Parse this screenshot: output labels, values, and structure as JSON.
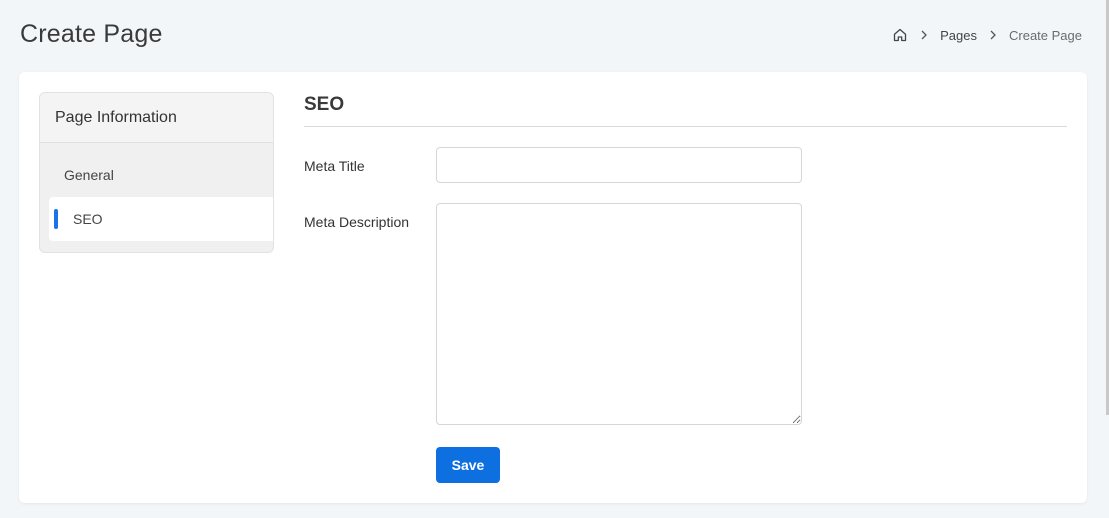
{
  "header": {
    "title": "Create Page",
    "breadcrumb": {
      "home_icon": "home-icon",
      "separator_icon": "chevron-right-icon",
      "items": [
        "Pages",
        "Create Page"
      ]
    }
  },
  "sidebar": {
    "title": "Page Information",
    "items": [
      {
        "label": "General",
        "active": false
      },
      {
        "label": "SEO",
        "active": true
      }
    ]
  },
  "main": {
    "section_title": "SEO",
    "fields": {
      "meta_title": {
        "label": "Meta Title",
        "value": "",
        "placeholder": ""
      },
      "meta_description": {
        "label": "Meta Description",
        "value": "",
        "placeholder": ""
      }
    },
    "save_label": "Save"
  },
  "colors": {
    "accent": "#0d6fe0",
    "background": "#f3f6f9",
    "card": "#ffffff"
  }
}
